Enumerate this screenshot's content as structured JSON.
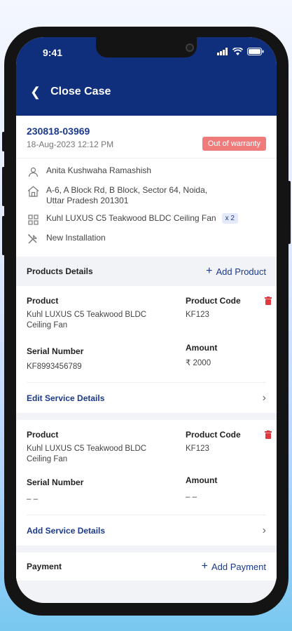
{
  "status_bar": {
    "time": "9:41"
  },
  "app_bar": {
    "title": "Close Case"
  },
  "case": {
    "id": "230818-03969",
    "date": "18-Aug-2023  12:12 PM",
    "warranty_badge": "Out of warranty",
    "customer_name": "Anita Kushwaha Ramashish",
    "address": "A-6, A Block Rd, B Block, Sector 64, Noida, Uttar Pradesh 201301",
    "product": "Kuhl LUXUS C5 Teakwood BLDC Ceiling Fan",
    "product_qty": "x 2",
    "service_type": "New Installation"
  },
  "products_section": {
    "title": "Products Details",
    "add_label": "Add Product"
  },
  "products": [
    {
      "product_label": "Product",
      "product_value": "Kuhl LUXUS C5 Teakwood BLDC Ceiling Fan",
      "code_label": "Product Code",
      "code_value": "KF123",
      "serial_label": "Serial Number",
      "serial_value": "KF8993456789",
      "amount_label": "Amount",
      "amount_value": "₹ 2000",
      "service_link": "Edit Service Details"
    },
    {
      "product_label": "Product",
      "product_value": "Kuhl LUXUS C5 Teakwood BLDC Ceiling Fan",
      "code_label": "Product Code",
      "code_value": "KF123",
      "serial_label": "Serial Number",
      "serial_value": "– –",
      "amount_label": "Amount",
      "amount_value": "– –",
      "service_link": "Add Service Details"
    }
  ],
  "payment_section": {
    "title": "Payment",
    "add_label": "Add Payment"
  },
  "colors": {
    "primary": "#0f2f7d",
    "accent": "#1c3a8c",
    "warning": "#f07b7b",
    "delete": "#e0383e"
  },
  "icons": {
    "back": "chevron-left-icon",
    "customer": "user-icon",
    "address": "home-icon",
    "product": "grid-icon",
    "service": "tools-icon",
    "delete": "trash-icon",
    "next": "chevron-right-icon"
  }
}
